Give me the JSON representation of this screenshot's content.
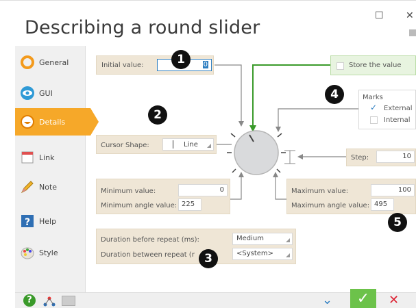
{
  "window": {
    "title": "Describing a round slider",
    "maximize_glyph": "☐",
    "close_glyph": "✕",
    "colors": {
      "accent": "#f6a829",
      "green": "#3a9a2a",
      "panel": "#efe6d6",
      "blue": "#2f7fc1"
    }
  },
  "sidebar": {
    "items": [
      {
        "label": "General",
        "icon": "orange-ring-icon"
      },
      {
        "label": "GUI",
        "icon": "eye-icon"
      },
      {
        "label": "Details",
        "icon": "smiley-icon",
        "active": true
      },
      {
        "label": "Link",
        "icon": "calendar-icon"
      },
      {
        "label": "Note",
        "icon": "pencil-icon"
      },
      {
        "label": "Help",
        "icon": "help-icon"
      },
      {
        "label": "Style",
        "icon": "palette-icon"
      }
    ]
  },
  "details": {
    "initial_value": {
      "label": "Initial value:",
      "value": "0"
    },
    "store_value": {
      "label": "Store the value",
      "checked": false
    },
    "marks": {
      "title": "Marks",
      "external": {
        "label": "External",
        "checked": true
      },
      "internal": {
        "label": "Internal",
        "checked": false
      }
    },
    "cursor_shape": {
      "label": "Cursor Shape:",
      "value": "Line"
    },
    "step": {
      "label": "Step:",
      "value": "10"
    },
    "minimum": {
      "label": "Minimum value:",
      "value": "0"
    },
    "minimum_angle": {
      "label": "Minimum angle value:",
      "value": "225"
    },
    "maximum": {
      "label": "Maximum value:",
      "value": "100"
    },
    "maximum_angle": {
      "label": "Maximum angle value:",
      "value": "495"
    },
    "repeat_before": {
      "label": "Duration before repeat (ms):",
      "value": "Medium"
    },
    "repeat_between": {
      "label": "Duration between repeat (r",
      "value": "<System>"
    }
  },
  "badges": [
    "1",
    "2",
    "3",
    "4",
    "5"
  ],
  "footer": {
    "help_glyph": "?",
    "ok_glyph": "✓",
    "cancel_glyph": "✕",
    "down_glyph": "⌄"
  }
}
